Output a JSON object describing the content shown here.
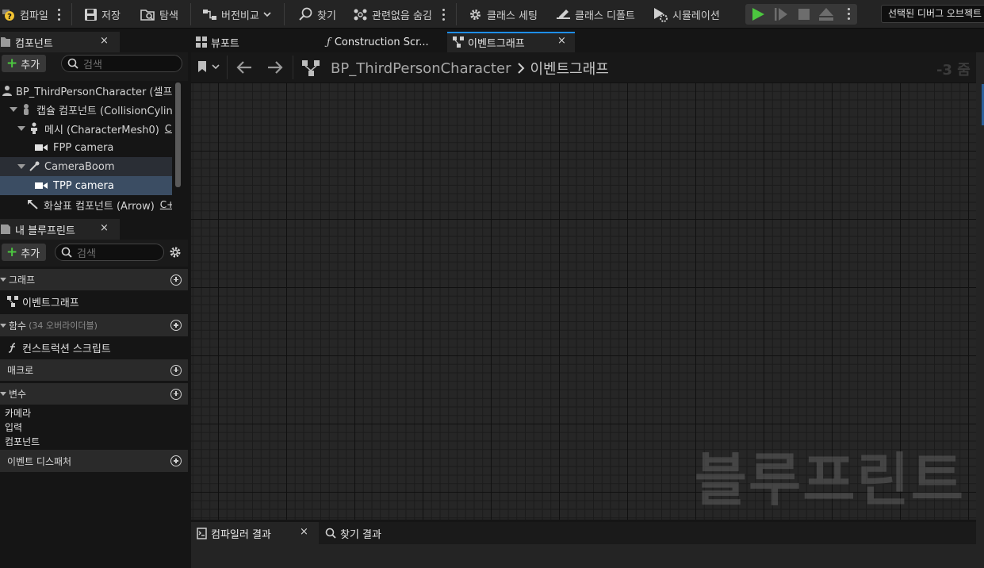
{
  "toolbar": {
    "compile": "컴파일",
    "save": "저장",
    "browse": "탐색",
    "diff": "버전비교",
    "find": "찾기",
    "hide_unrelated": "관련없음 숨김",
    "class_settings": "클래스 세팅",
    "class_defaults": "클래스 디폴트",
    "simulation": "시뮬레이션",
    "debug_object": "선택된 디버그 오브젝트"
  },
  "components_panel": {
    "tab_title": "컴포넌트",
    "close": "×",
    "add_label": "추가",
    "search_placeholder": "검색",
    "tree": [
      {
        "label": "BP_ThirdPersonCharacter (셀프)",
        "icon": "character-icon"
      },
      {
        "label": "캡슐 컴포넌트 (CollisionCylinder)",
        "icon": "capsule-icon"
      },
      {
        "label": "메시 (CharacterMesh0)",
        "icon": "skeletal-mesh-icon",
        "badge": "C++"
      },
      {
        "label": "FPP camera",
        "icon": "camera-icon"
      },
      {
        "label": "CameraBoom",
        "icon": "spring-arm-icon"
      },
      {
        "label": "TPP camera",
        "icon": "camera-icon"
      },
      {
        "label": "화살표 컴포넌트 (Arrow)",
        "icon": "arrow-icon",
        "badge": "C++"
      }
    ]
  },
  "my_blueprint": {
    "tab_title": "내 블루프린트",
    "close": "×",
    "add_label": "추가",
    "search_placeholder": "검색",
    "graphs_header": "그래프",
    "event_graph": "이벤트그래프",
    "functions_header": "함수",
    "functions_count": "(34 오버라이더블)",
    "construction_script": "컨스트럭션 스크립트",
    "macros_header": "매크로",
    "variables_header": "변수",
    "variable_groups": [
      "카메라",
      "입력",
      "컴포넌트"
    ],
    "dispatchers_header": "이벤트 디스패처"
  },
  "tabs": {
    "viewport": "뷰포트",
    "construction": "Construction Scr...",
    "event_graph": "이벤트그래프",
    "close": "×"
  },
  "graph": {
    "breadcrumb_root": "BP_ThirdPersonCharacter",
    "breadcrumb_current": "이벤트그래프",
    "zoom": "-3 줌",
    "watermark": "블루프린트"
  },
  "bottom_tabs": {
    "compiler_results": "컴파일러 결과",
    "close": "×",
    "find_results": "찾기 결과"
  },
  "colors": {
    "accent_play": "#4cc73f",
    "selection": "#3b4d63",
    "tab_active_line": "#1e8fff"
  }
}
